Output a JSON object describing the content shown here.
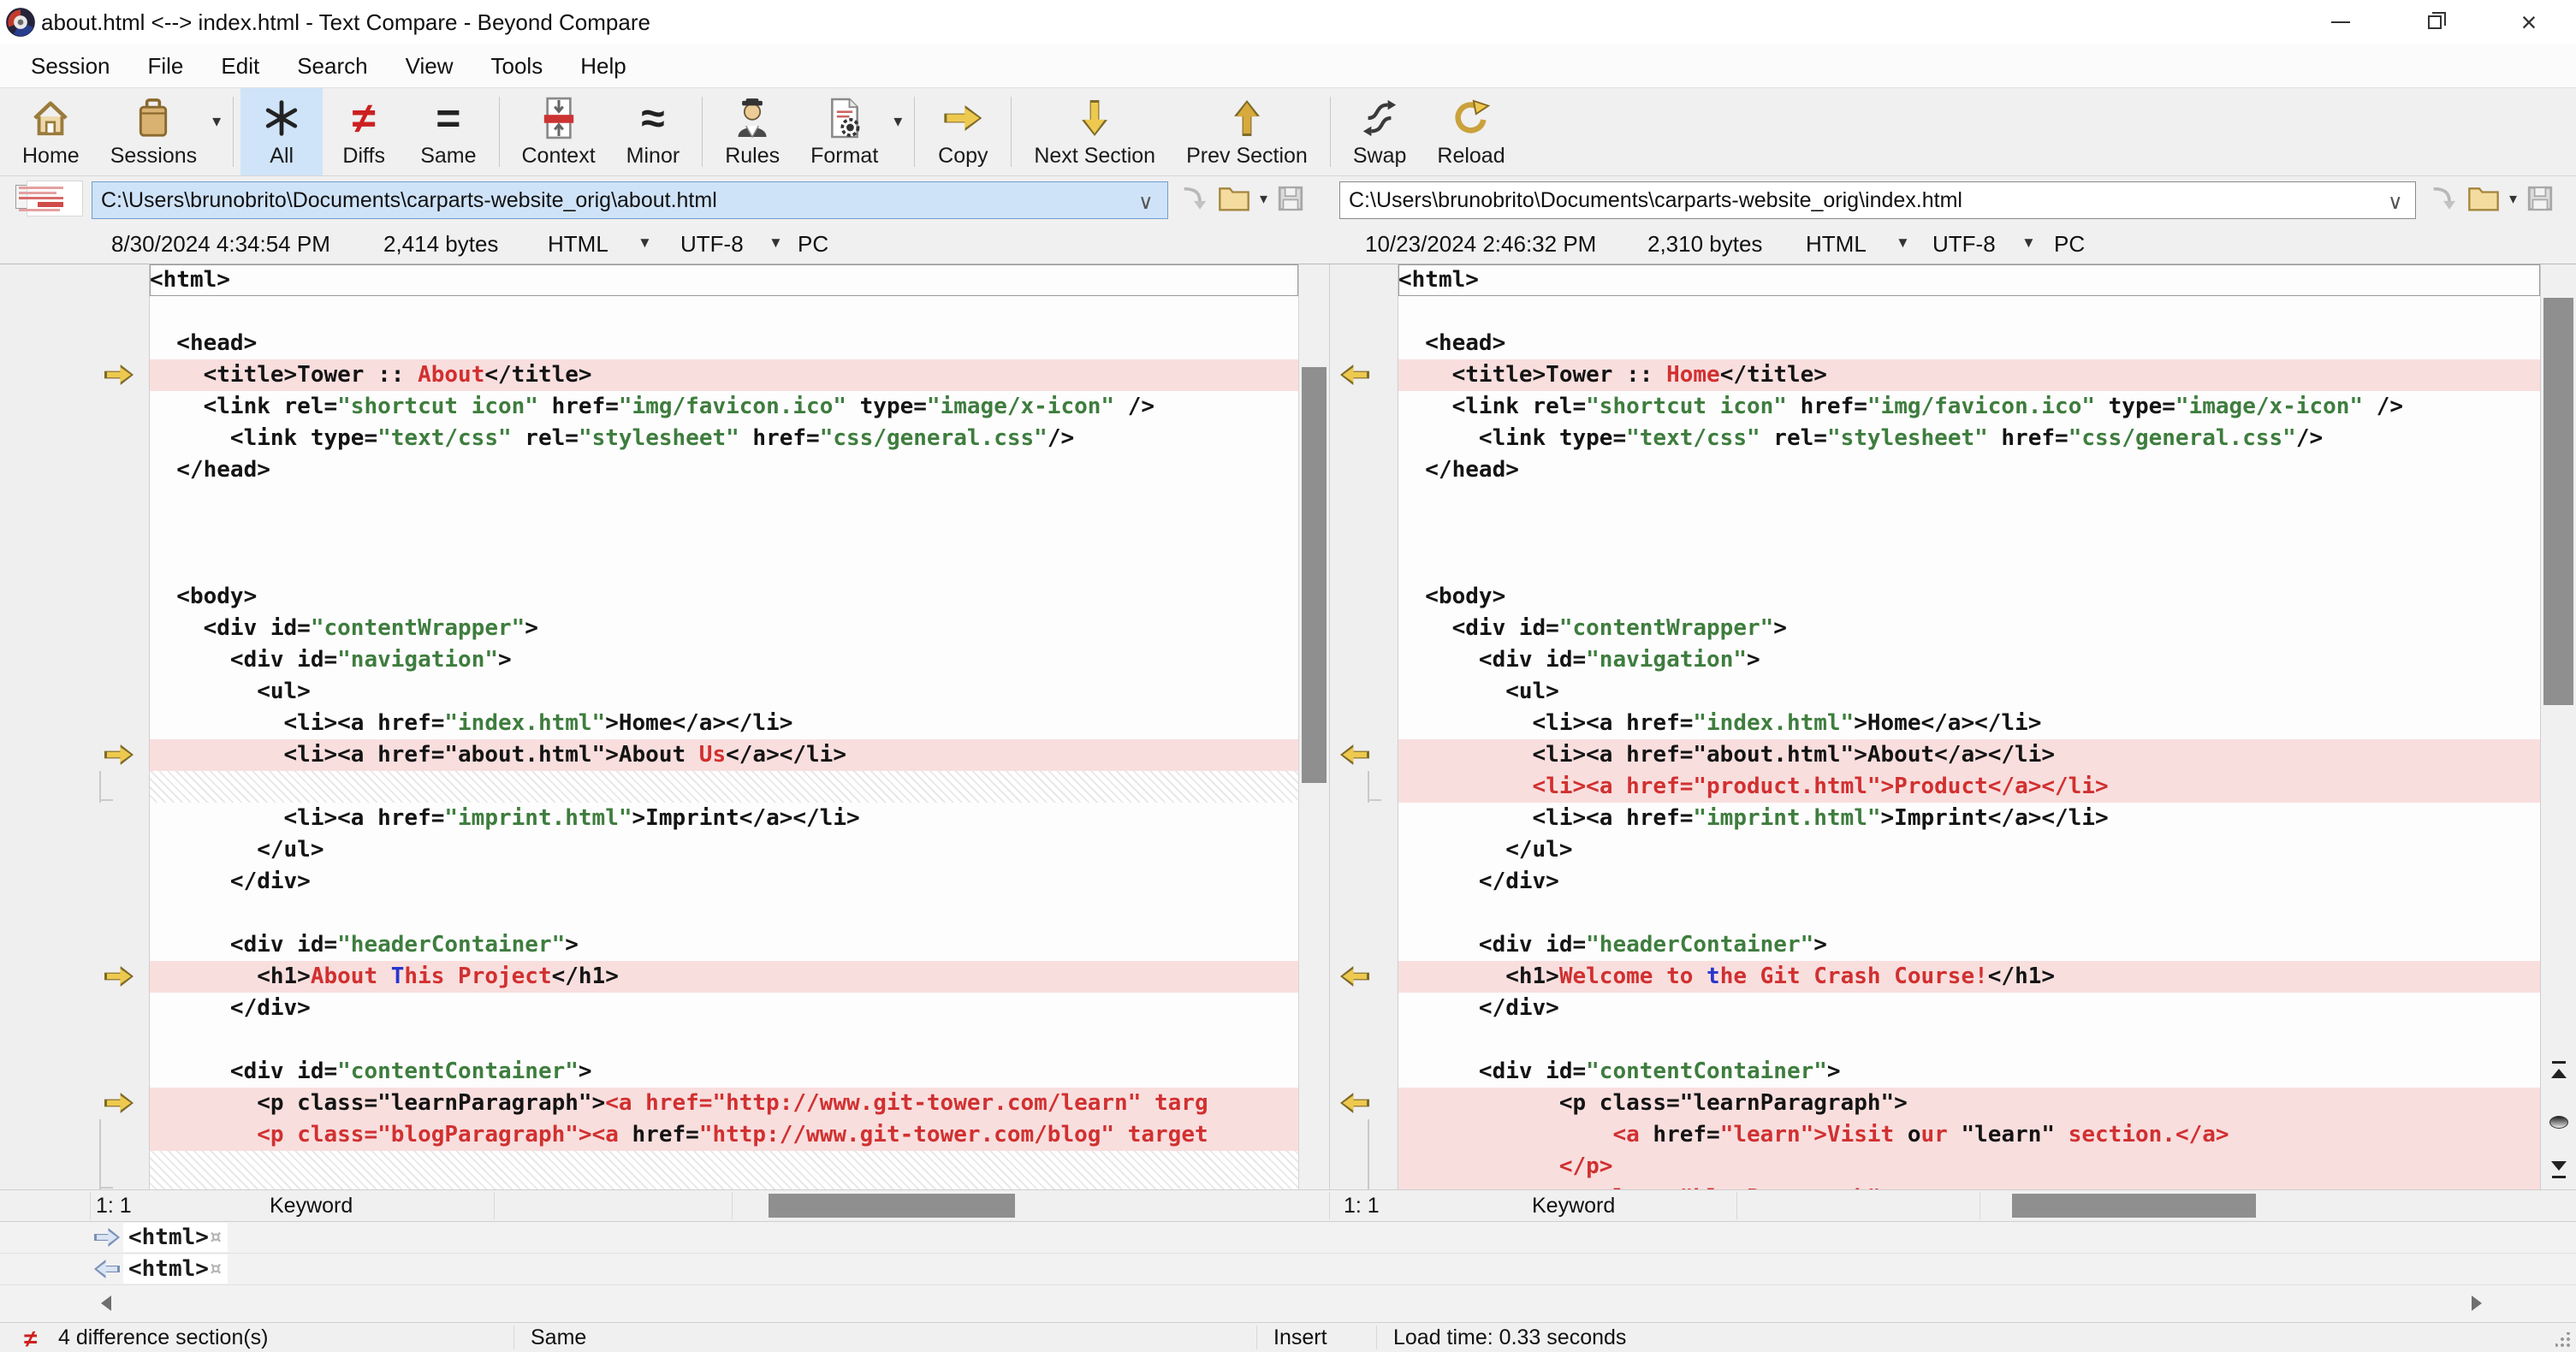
{
  "window": {
    "title": "about.html <--> index.html - Text Compare - Beyond Compare"
  },
  "menu": {
    "items": [
      {
        "label": "Session"
      },
      {
        "label": "File"
      },
      {
        "label": "Edit"
      },
      {
        "label": "Search"
      },
      {
        "label": "View"
      },
      {
        "label": "Tools"
      },
      {
        "label": "Help"
      }
    ]
  },
  "toolbar": {
    "buttons": [
      {
        "label": "Home"
      },
      {
        "label": "Sessions"
      },
      {
        "label": "All"
      },
      {
        "label": "Diffs"
      },
      {
        "label": "Same"
      },
      {
        "label": "Context"
      },
      {
        "label": "Minor"
      },
      {
        "label": "Rules"
      },
      {
        "label": "Format"
      },
      {
        "label": "Copy"
      },
      {
        "label": "Next Section"
      },
      {
        "label": "Prev Section"
      },
      {
        "label": "Swap"
      },
      {
        "label": "Reload"
      }
    ]
  },
  "paths": {
    "left": {
      "value": "C:\\Users\\brunobrito\\Documents\\carparts-website_orig\\about.html"
    },
    "right": {
      "value": "C:\\Users\\brunobrito\\Documents\\carparts-website_orig\\index.html"
    }
  },
  "fileinfo": {
    "left": {
      "modified": "8/30/2024 4:34:54 PM",
      "size": "2,414 bytes",
      "format": "HTML",
      "encoding": "UTF-8",
      "line_ending": "PC"
    },
    "right": {
      "modified": "10/23/2024 2:46:32 PM",
      "size": "2,310 bytes",
      "format": "HTML",
      "encoding": "UTF-8",
      "line_ending": "PC"
    }
  },
  "panes": {
    "left": {
      "status": {
        "position": "1: 1",
        "grammar": "Keyword"
      },
      "lines": [
        {
          "frame": true,
          "seg": [
            [
              "<html>",
              "t"
            ]
          ]
        },
        {
          "seg": []
        },
        {
          "seg": [
            [
              "  <head>",
              "t"
            ]
          ]
        },
        {
          "diff": true,
          "marker": true,
          "seg": [
            [
              "    <title>Tower :: ",
              "t"
            ],
            [
              "About",
              "r"
            ],
            [
              "</title>",
              "t"
            ]
          ]
        },
        {
          "seg": [
            [
              "    <link rel=",
              "t"
            ],
            [
              "\"shortcut icon\"",
              "s"
            ],
            [
              " href=",
              "t"
            ],
            [
              "\"img/favicon.ico\"",
              "s"
            ],
            [
              " type=",
              "t"
            ],
            [
              "\"image/x-icon\"",
              "s"
            ],
            [
              " />",
              "t"
            ]
          ]
        },
        {
          "seg": [
            [
              "      <link type=",
              "t"
            ],
            [
              "\"text/css\"",
              "s"
            ],
            [
              " rel=",
              "t"
            ],
            [
              "\"stylesheet\"",
              "s"
            ],
            [
              " href=",
              "t"
            ],
            [
              "\"css/general.css\"",
              "s"
            ],
            [
              "/>",
              "t"
            ]
          ]
        },
        {
          "seg": [
            [
              "  </head>",
              "t"
            ]
          ]
        },
        {
          "seg": []
        },
        {
          "seg": []
        },
        {
          "seg": []
        },
        {
          "seg": [
            [
              "  <body>",
              "t"
            ]
          ]
        },
        {
          "seg": [
            [
              "    <div id=",
              "t"
            ],
            [
              "\"contentWrapper\"",
              "s"
            ],
            [
              ">",
              "t"
            ]
          ]
        },
        {
          "seg": [
            [
              "      <div id=",
              "t"
            ],
            [
              "\"navigation\"",
              "s"
            ],
            [
              ">",
              "t"
            ]
          ]
        },
        {
          "seg": [
            [
              "        <ul>",
              "t"
            ]
          ]
        },
        {
          "seg": [
            [
              "          <li><a href=",
              "t"
            ],
            [
              "\"index.html\"",
              "s"
            ],
            [
              ">Home</a></li>",
              "t"
            ]
          ]
        },
        {
          "diff": true,
          "marker": true,
          "seg": [
            [
              "          <li><a href=\"about.html\">About ",
              "t"
            ],
            [
              "Us",
              "r"
            ],
            [
              "</a></li>",
              "t"
            ]
          ]
        },
        {
          "gap": true,
          "bracket": true,
          "bracket_end": true,
          "seg": []
        },
        {
          "seg": [
            [
              "          <li><a href=",
              "t"
            ],
            [
              "\"imprint.html\"",
              "s"
            ],
            [
              ">Imprint</a></li>",
              "t"
            ]
          ]
        },
        {
          "seg": [
            [
              "        </ul>",
              "t"
            ]
          ]
        },
        {
          "seg": [
            [
              "      </div>",
              "t"
            ]
          ]
        },
        {
          "seg": []
        },
        {
          "seg": [
            [
              "      <div id=",
              "t"
            ],
            [
              "\"headerContainer\"",
              "s"
            ],
            [
              ">",
              "t"
            ]
          ]
        },
        {
          "diff": true,
          "marker": true,
          "seg": [
            [
              "        <h1>",
              "t"
            ],
            [
              "About ",
              "r"
            ],
            [
              "T",
              "b"
            ],
            [
              "his Project",
              "r"
            ],
            [
              "</h1>",
              "t"
            ]
          ]
        },
        {
          "seg": [
            [
              "      </div>",
              "t"
            ]
          ]
        },
        {
          "seg": []
        },
        {
          "seg": [
            [
              "      <div id=",
              "t"
            ],
            [
              "\"contentContainer\"",
              "s"
            ],
            [
              ">",
              "t"
            ]
          ]
        },
        {
          "diff": true,
          "marker": true,
          "seg": [
            [
              "        <p class=\"learnParagraph\">",
              "t"
            ],
            [
              "<a href=\"http://www.git-tower.com/learn\" targ",
              "r"
            ]
          ]
        },
        {
          "diff": true,
          "bracket": true,
          "seg": [
            [
              "        ",
              "t"
            ],
            [
              "<p class=\"blogParagraph\"><a ",
              "r"
            ],
            [
              "href=",
              "t"
            ],
            [
              "\"http://www.git-tower.com/blog\" target",
              "r"
            ]
          ]
        },
        {
          "gap": true,
          "bracket": true,
          "bracket_end": true,
          "h": 46,
          "seg": []
        }
      ]
    },
    "right": {
      "status": {
        "position": "1: 1",
        "grammar": "Keyword"
      },
      "lines": [
        {
          "frame": true,
          "seg": [
            [
              "<html>",
              "t"
            ]
          ]
        },
        {
          "seg": []
        },
        {
          "seg": [
            [
              "  <head>",
              "t"
            ]
          ]
        },
        {
          "diff": true,
          "marker": true,
          "seg": [
            [
              "    <title>Tower :: ",
              "t"
            ],
            [
              "Home",
              "r"
            ],
            [
              "</title>",
              "t"
            ]
          ]
        },
        {
          "seg": [
            [
              "    <link rel=",
              "t"
            ],
            [
              "\"shortcut icon\"",
              "s"
            ],
            [
              " href=",
              "t"
            ],
            [
              "\"img/favicon.ico\"",
              "s"
            ],
            [
              " type=",
              "t"
            ],
            [
              "\"image/x-icon\"",
              "s"
            ],
            [
              " />",
              "t"
            ]
          ]
        },
        {
          "seg": [
            [
              "      <link type=",
              "t"
            ],
            [
              "\"text/css\"",
              "s"
            ],
            [
              " rel=",
              "t"
            ],
            [
              "\"stylesheet\"",
              "s"
            ],
            [
              " href=",
              "t"
            ],
            [
              "\"css/general.css\"",
              "s"
            ],
            [
              "/>",
              "t"
            ]
          ]
        },
        {
          "seg": [
            [
              "  </head>",
              "t"
            ]
          ]
        },
        {
          "seg": []
        },
        {
          "seg": []
        },
        {
          "seg": []
        },
        {
          "seg": [
            [
              "  <body>",
              "t"
            ]
          ]
        },
        {
          "seg": [
            [
              "    <div id=",
              "t"
            ],
            [
              "\"contentWrapper\"",
              "s"
            ],
            [
              ">",
              "t"
            ]
          ]
        },
        {
          "seg": [
            [
              "      <div id=",
              "t"
            ],
            [
              "\"navigation\"",
              "s"
            ],
            [
              ">",
              "t"
            ]
          ]
        },
        {
          "seg": [
            [
              "        <ul>",
              "t"
            ]
          ]
        },
        {
          "seg": [
            [
              "          <li><a href=",
              "t"
            ],
            [
              "\"index.html\"",
              "s"
            ],
            [
              ">Home</a></li>",
              "t"
            ]
          ]
        },
        {
          "diff": true,
          "marker": true,
          "seg": [
            [
              "          <li><a href=\"about.html\">About</a></li>",
              "t"
            ]
          ]
        },
        {
          "diff": true,
          "bracket": true,
          "bracket_end": true,
          "seg": [
            [
              "          ",
              "t"
            ],
            [
              "<li><a href=\"product.html\">Product</a></li>",
              "r"
            ]
          ]
        },
        {
          "seg": [
            [
              "          <li><a href=",
              "t"
            ],
            [
              "\"imprint.html\"",
              "s"
            ],
            [
              ">Imprint</a></li>",
              "t"
            ]
          ]
        },
        {
          "seg": [
            [
              "        </ul>",
              "t"
            ]
          ]
        },
        {
          "seg": [
            [
              "      </div>",
              "t"
            ]
          ]
        },
        {
          "seg": []
        },
        {
          "seg": [
            [
              "      <div id=",
              "t"
            ],
            [
              "\"headerContainer\"",
              "s"
            ],
            [
              ">",
              "t"
            ]
          ]
        },
        {
          "diff": true,
          "marker": true,
          "seg": [
            [
              "        <h1>",
              "t"
            ],
            [
              "Welcome to ",
              "r"
            ],
            [
              "t",
              "b"
            ],
            [
              "he Git Crash Course!",
              "r"
            ],
            [
              "</h1>",
              "t"
            ]
          ]
        },
        {
          "seg": [
            [
              "      </div>",
              "t"
            ]
          ]
        },
        {
          "seg": []
        },
        {
          "seg": [
            [
              "      <div id=",
              "t"
            ],
            [
              "\"contentContainer\"",
              "s"
            ],
            [
              ">",
              "t"
            ]
          ]
        },
        {
          "diff": true,
          "marker": true,
          "seg": [
            [
              "            <p class=\"learnParagraph\">",
              "t"
            ]
          ]
        },
        {
          "diff": true,
          "bracket": true,
          "seg": [
            [
              "                ",
              "t"
            ],
            [
              "<a ",
              "r"
            ],
            [
              "href=",
              "t"
            ],
            [
              "\"learn\">Visit ",
              "r"
            ],
            [
              "o",
              "t"
            ],
            [
              "ur ",
              "r"
            ],
            [
              "\"learn\"",
              "t"
            ],
            [
              " section.</a>",
              "r"
            ]
          ]
        },
        {
          "diff": true,
          "bracket": true,
          "seg": [
            [
              "            ",
              "t"
            ],
            [
              "</p>",
              "r"
            ]
          ]
        },
        {
          "diff": true,
          "bracket": true,
          "seg": [
            [
              "            ",
              "t"
            ],
            [
              "<p class=\"blogParagraph\">",
              "r"
            ]
          ]
        }
      ]
    }
  },
  "details": {
    "rows": [
      {
        "direction": "right",
        "text": "<html>",
        "eol": "¤"
      },
      {
        "direction": "left",
        "text": "<html>",
        "eol": "¤"
      }
    ]
  },
  "statusbar": {
    "diff_count": "4 difference section(s)",
    "neq_icon": "≠",
    "view_mode": "Same",
    "insert_mode": "Insert",
    "load_time": "Load time: 0.33 seconds"
  },
  "glyphs": {
    "combo": "∨",
    "dropdown": "▾",
    "diffs": "≠",
    "same": "=",
    "minor": "≈"
  },
  "colors": {
    "selection_blue": "#cfe3f8",
    "active_button": "#cfe4f8",
    "diff_row_bg": "#f9dede",
    "diff_text_red": "#d13030",
    "string_green": "#3e7d3e",
    "minor_blue": "#2936cc",
    "marker_gold": "#eec94f",
    "scroll_thumb": "#8f8f8f"
  }
}
